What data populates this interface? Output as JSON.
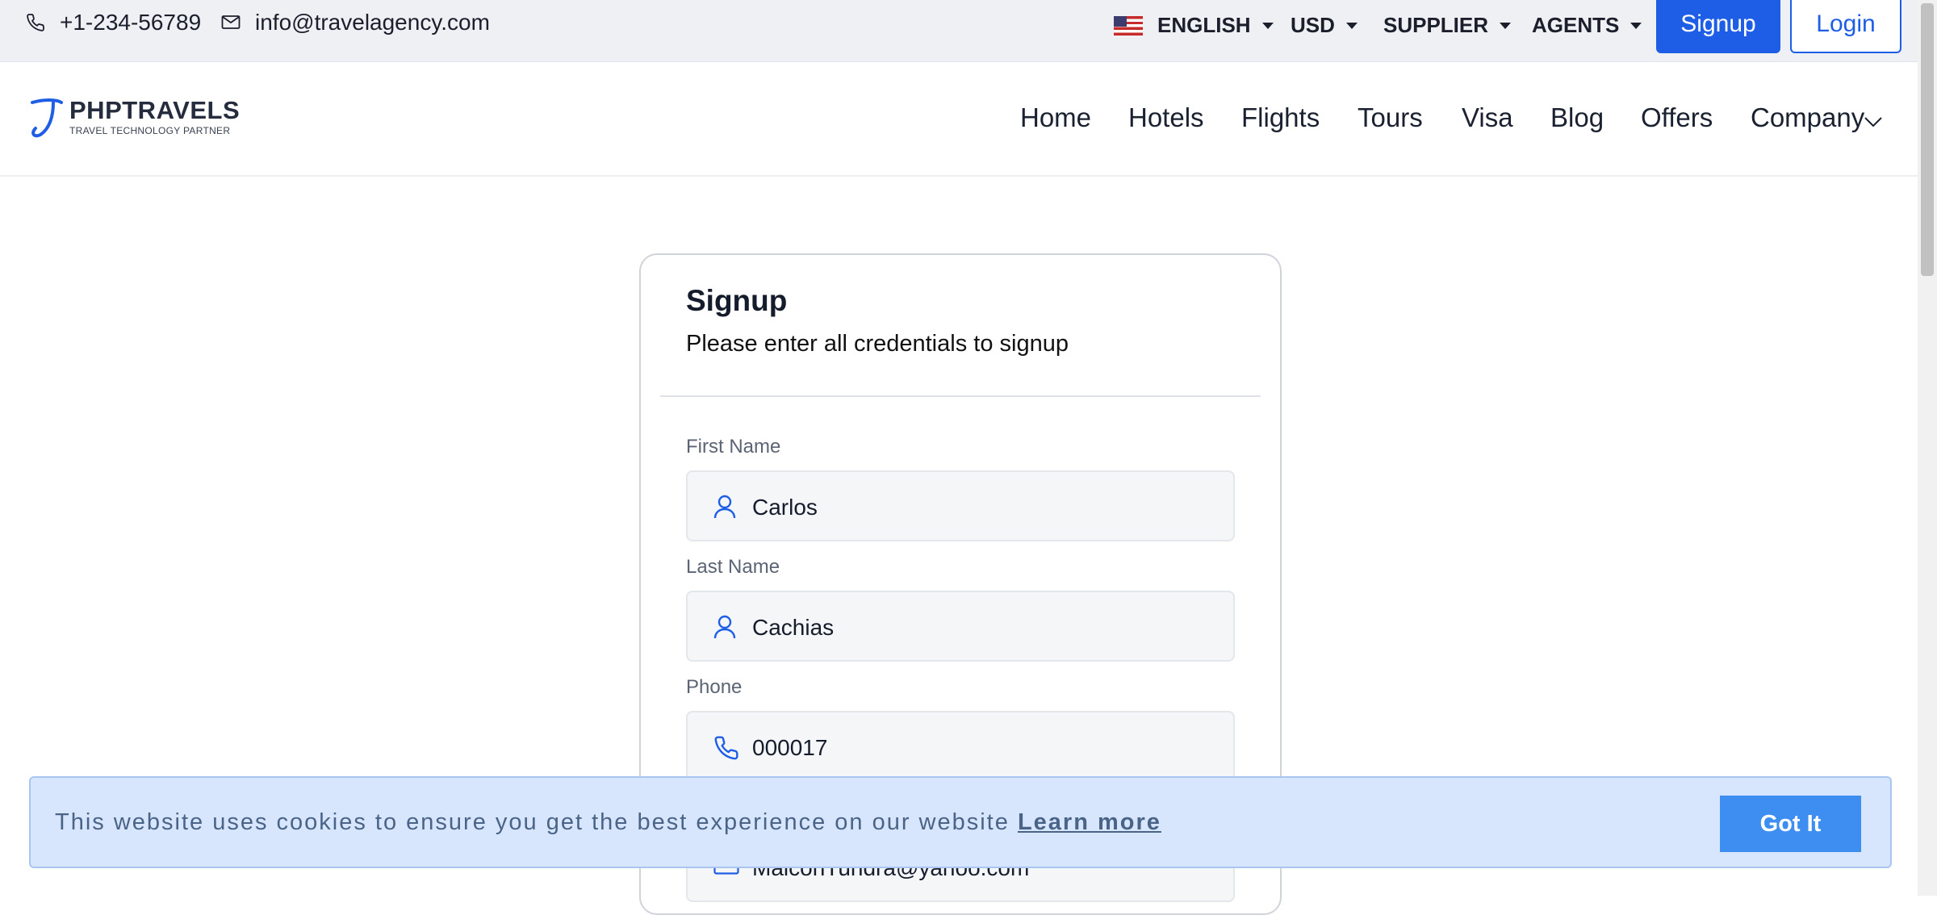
{
  "topbar": {
    "phone": "+1-234-56789",
    "email": "info@travelagency.com",
    "language": "ENGLISH",
    "currency": "USD",
    "supplier": "SUPPLIER",
    "agents": "AGENTS",
    "signup_label": "Signup",
    "login_label": "Login"
  },
  "brand": {
    "name": "PHPTRAVELS",
    "tagline": "TRAVEL TECHNOLOGY PARTNER",
    "accent": "#1e5ee6"
  },
  "nav": {
    "items": [
      "Home",
      "Hotels",
      "Flights",
      "Tours",
      "Visa",
      "Blog",
      "Offers",
      "Company"
    ]
  },
  "form": {
    "title": "Signup",
    "subtitle": "Please enter all credentials to signup",
    "fields": [
      {
        "label": "First Name",
        "value": "Carlos",
        "icon": "user-icon"
      },
      {
        "label": "Last Name",
        "value": "Cachias",
        "icon": "user-icon"
      },
      {
        "label": "Phone",
        "value": "000017",
        "icon": "phone-icon"
      },
      {
        "label": "",
        "value": "MalconTundra@yahoo.com",
        "icon": "email-icon"
      }
    ]
  },
  "cookie": {
    "message": "This website uses cookies to ensure you get the best experience on our website",
    "link_label": "Learn more",
    "button_label": "Got It",
    "background": "#d8e6fd",
    "button_color": "#3d8ef0"
  }
}
